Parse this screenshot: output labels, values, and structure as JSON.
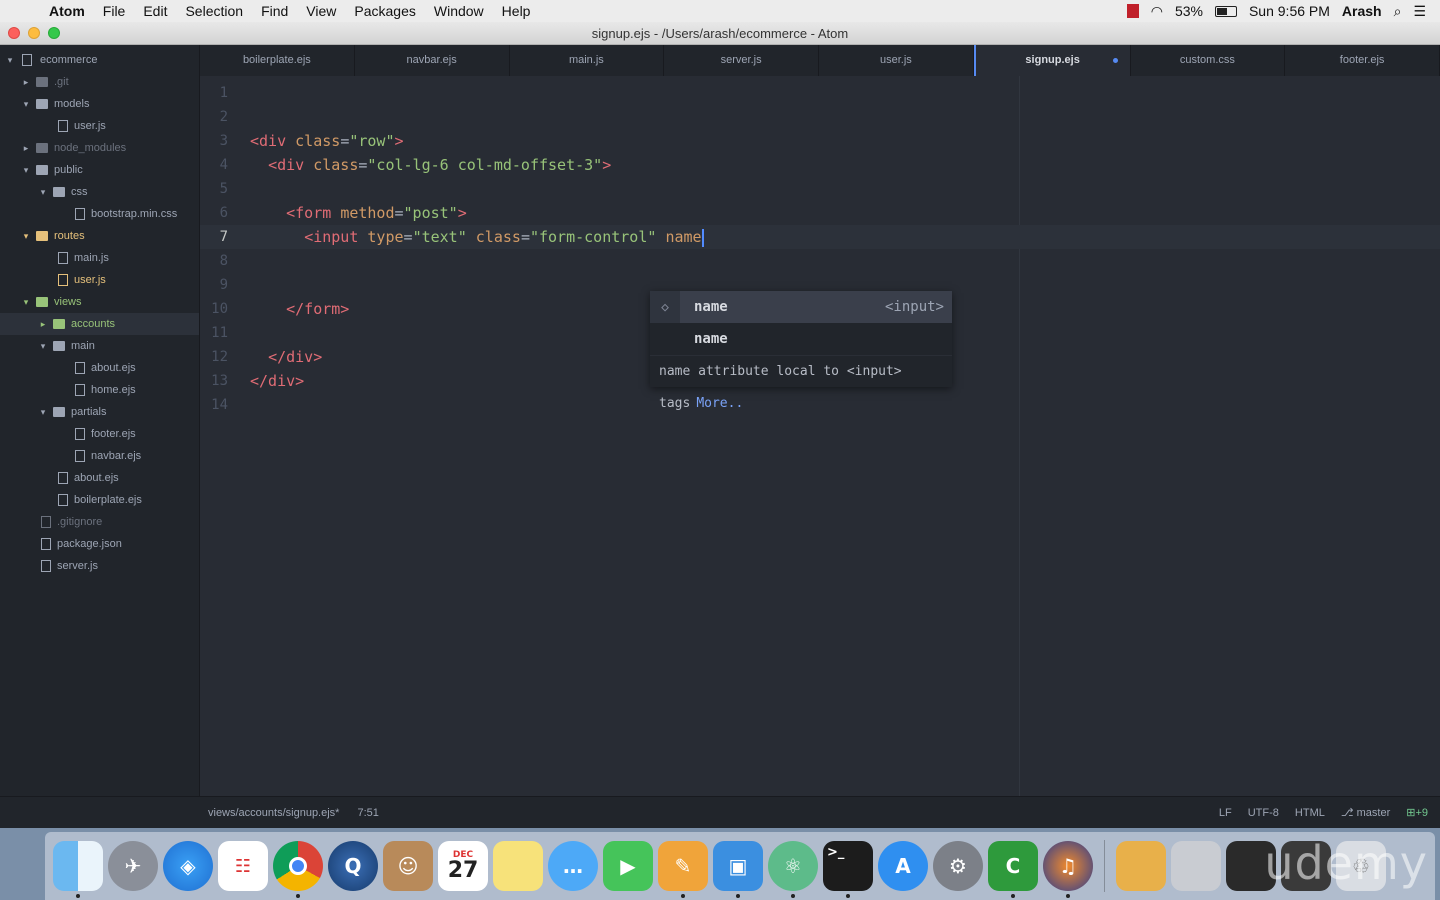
{
  "menubar": {
    "app": "Atom",
    "items": [
      "File",
      "Edit",
      "Selection",
      "Find",
      "View",
      "Packages",
      "Window",
      "Help"
    ],
    "battery": "53%",
    "clock": "Sun 9:56 PM",
    "user": "Arash"
  },
  "window": {
    "title": "signup.ejs - /Users/arash/ecommerce - Atom"
  },
  "tree": {
    "root": "ecommerce",
    "items": [
      {
        "label": ".git"
      },
      {
        "label": "models"
      },
      {
        "label": "user.js"
      },
      {
        "label": "node_modules"
      },
      {
        "label": "public"
      },
      {
        "label": "css"
      },
      {
        "label": "bootstrap.min.css"
      },
      {
        "label": "routes"
      },
      {
        "label": "main.js"
      },
      {
        "label": "user.js"
      },
      {
        "label": "views"
      },
      {
        "label": "accounts"
      },
      {
        "label": "main"
      },
      {
        "label": "about.ejs"
      },
      {
        "label": "home.ejs"
      },
      {
        "label": "partials"
      },
      {
        "label": "footer.ejs"
      },
      {
        "label": "navbar.ejs"
      },
      {
        "label": "about.ejs"
      },
      {
        "label": "boilerplate.ejs"
      },
      {
        "label": ".gitignore"
      },
      {
        "label": "package.json"
      },
      {
        "label": "server.js"
      }
    ]
  },
  "tabs": [
    "boilerplate.ejs",
    "navbar.ejs",
    "main.js",
    "server.js",
    "user.js",
    "signup.ejs",
    "custom.css",
    "footer.ejs"
  ],
  "code": {
    "line_numbers": [
      "1",
      "2",
      "3",
      "4",
      "5",
      "6",
      "7",
      "8",
      "9",
      "10",
      "11",
      "12",
      "13",
      "14"
    ],
    "l3": {
      "indent": "",
      "open": "<div",
      "a1": "class",
      "eq": "=",
      "v1": "\"row\"",
      "close": ">"
    },
    "l4": {
      "indent": "  ",
      "open": "<div",
      "a1": "class",
      "eq": "=",
      "v1": "\"col-lg-6 col-md-offset-3\"",
      "close": ">"
    },
    "l6": {
      "indent": "    ",
      "open": "<form",
      "a1": "method",
      "eq": "=",
      "v1": "\"post\"",
      "close": ">"
    },
    "l7": {
      "indent": "      ",
      "open": "<input",
      "a1": "type",
      "eq": "=",
      "v1": "\"text\"",
      "a2": "class",
      "v2": "\"form-control\"",
      "typed": "name"
    },
    "l10": {
      "indent": "    ",
      "tag": "</form>"
    },
    "l12": {
      "indent": "  ",
      "tag": "</div>"
    },
    "l13": {
      "indent": "",
      "tag": "</div>"
    }
  },
  "autocomplete": {
    "suggestions": [
      {
        "text": "name",
        "right": "<input>"
      },
      {
        "text": "name",
        "right": ""
      }
    ],
    "description": "name attribute local to <input> tags",
    "more": "More.."
  },
  "status": {
    "path": "views/accounts/signup.ejs*",
    "position": "7:51",
    "line_ending": "LF",
    "encoding": "UTF-8",
    "grammar": "HTML",
    "branch": "master",
    "diff": "+9"
  },
  "dock": {
    "calendar_month": "DEC",
    "calendar_day": "27",
    "watermark": "udemy"
  }
}
